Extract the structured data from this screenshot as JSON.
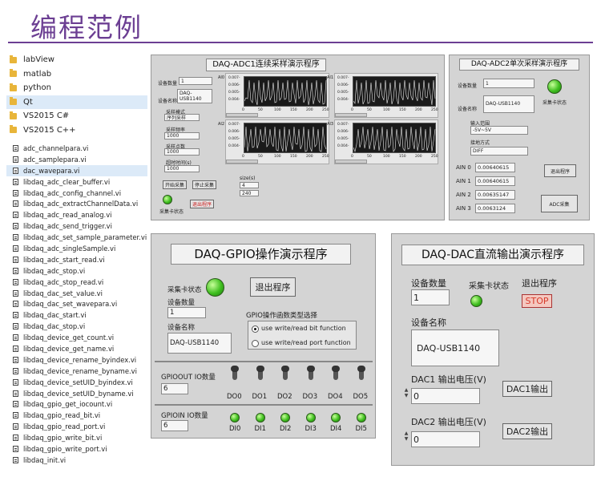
{
  "page": {
    "title": "编程范例"
  },
  "folders": [
    "labView",
    "matlab",
    "python",
    "Qt",
    "VS2015 C#",
    "VS2015 C++"
  ],
  "files": [
    "adc_channelpara.vi",
    "adc_samplepara.vi",
    "dac_wavepara.vi",
    "libdaq_adc_clear_buffer.vi",
    "libdaq_adc_config_channel.vi",
    "libdaq_adc_extractChannelData.vi",
    "libdaq_adc_read_analog.vi",
    "libdaq_adc_send_trigger.vi",
    "libdaq_adc_set_sample_parameter.vi",
    "libdaq_adc_singleSample.vi",
    "libdaq_adc_start_read.vi",
    "libdaq_adc_stop.vi",
    "libdaq_adc_stop_read.vi",
    "libdaq_dac_set_value.vi",
    "libdaq_dac_set_wavepara.vi",
    "libdaq_dac_start.vi",
    "libdaq_dac_stop.vi",
    "libdaq_device_get_count.vi",
    "libdaq_device_get_name.vi",
    "libdaq_device_rename_byindex.vi",
    "libdaq_device_rename_byname.vi",
    "libdaq_device_setUID_byindex.vi",
    "libdaq_device_setUID_byname.vi",
    "libdaq_gpio_get_iocount.vi",
    "libdaq_gpio_read_bit.vi",
    "libdaq_gpio_read_port.vi",
    "libdaq_gpio_write_bit.vi",
    "libdaq_gpio_write_port.vi",
    "libdaq_init.vi"
  ],
  "adc1": {
    "title": "DAQ-ADC1连续采样演示程序",
    "count_label": "设备数量",
    "count": "1",
    "name_label": "设备名称",
    "name": "DAQ-USB1140",
    "mode_label": "采样模式",
    "mode": "序列采样",
    "rate_label": "采样频率",
    "rate": "1000",
    "points_label": "采样点数",
    "points": "1000",
    "timeout_label": "超时时间(s)",
    "timeout": "1000",
    "start": "开始采集",
    "stop": "停止采集",
    "exit": "退出程序",
    "led_label": "采集卡状态",
    "size_label": "size(s)",
    "size1": "4",
    "size2": "240",
    "ch": [
      "AI0",
      "AI1",
      "AI2",
      "AI3"
    ],
    "yticks": [
      "0.007-",
      "0.006-",
      "0.005-",
      "0.004-"
    ],
    "xticks": [
      "0",
      "50",
      "100",
      "150",
      "200",
      "250"
    ]
  },
  "adc2": {
    "title": "DAQ-ADC2单次采样演示程序",
    "count_label": "设备数量",
    "count": "1",
    "led_label": "采集卡状态",
    "name_label": "设备名称",
    "name": "DAQ-USB1140",
    "range_label": "输入范围",
    "range": "-5V~5V",
    "mode_label": "接地方式",
    "mode": "DIFF",
    "ain": [
      {
        "label": "AIN 0",
        "value": "0.00640615"
      },
      {
        "label": "AIN 1",
        "value": "0.00640615"
      },
      {
        "label": "AIN 2",
        "value": "0.00635147"
      },
      {
        "label": "AIN 3",
        "value": "0.0063124"
      }
    ],
    "exit": "退出程序",
    "acquire": "ADC采集"
  },
  "gpio": {
    "title": "DAQ-GPIO操作演示程序",
    "led_label": "采集卡状态",
    "count_label": "设备数量",
    "count": "1",
    "name_label": "设备名称",
    "name": "DAQ-USB1140",
    "exit": "退出程序",
    "fn_label": "GPIO操作函数类型选择",
    "opt1": "use write/read bit function",
    "opt2": "use write/read port function",
    "out_label": "GPIOOUT IO数量",
    "out_count": "6",
    "in_label": "GPIOIN IO数量",
    "in_count": "6",
    "do": [
      "DO0",
      "DO1",
      "DO2",
      "DO3",
      "DO4",
      "DO5"
    ],
    "di": [
      "DI0",
      "DI1",
      "DI2",
      "DI3",
      "DI4",
      "DI5"
    ]
  },
  "dac": {
    "title": "DAQ-DAC直流输出演示程序",
    "count_label": "设备数量",
    "count": "1",
    "led_label": "采集卡状态",
    "exit_label": "退出程序",
    "stop": "STOP",
    "name_label": "设备名称",
    "name": "DAQ-USB1140",
    "dac1_label": "DAC1 输出电压(V)",
    "dac1_value": "0",
    "dac1_btn": "DAC1输出",
    "dac2_label": "DAC2 输出电压(V)",
    "dac2_value": "0",
    "dac2_btn": "DAC2输出"
  },
  "colors": {
    "accent": "#6c3f93",
    "led_on": "#3fbf1f",
    "stop_red": "#d83a2a",
    "folder": "#e8b53a"
  }
}
